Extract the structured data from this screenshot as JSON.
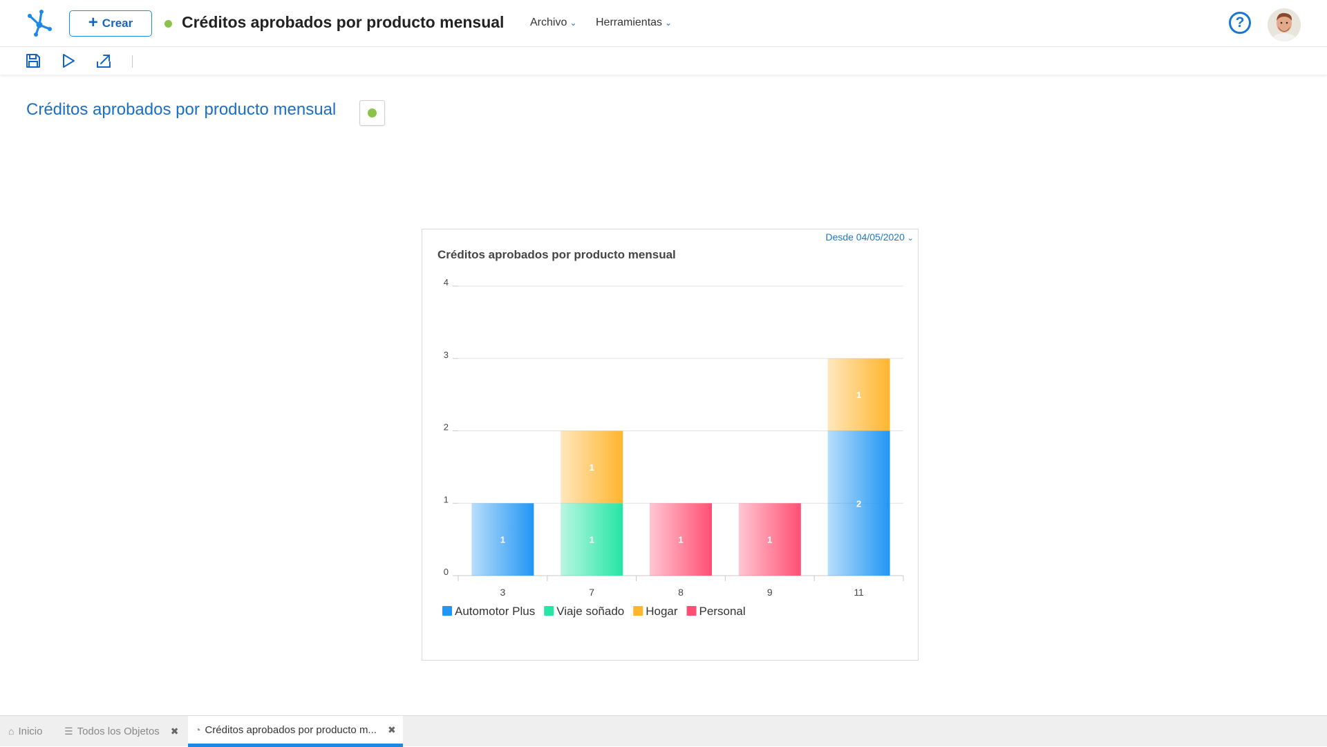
{
  "header": {
    "create_label": "Crear",
    "document_title": "Créditos aprobados por producto mensual",
    "menus": [
      {
        "label": "Archivo"
      },
      {
        "label": "Herramientas"
      }
    ],
    "help_symbol": "?"
  },
  "toolbar": {
    "icons": [
      "save-icon",
      "run-icon",
      "export-icon"
    ]
  },
  "page": {
    "title": "Créditos aprobados por producto mensual"
  },
  "card": {
    "date_filter": "Desde 04/05/2020"
  },
  "colors": {
    "accent": "#1976d2",
    "status_dot": "#8bc34a",
    "automotor_plus": "#2196f3",
    "viaje_sonado": "#26e5a5",
    "hogar": "#ffb52e",
    "personal": "#ff4f73"
  },
  "chart_data": {
    "type": "bar",
    "stacked": true,
    "title": "Créditos aprobados por producto mensual",
    "xlabel": "",
    "ylabel": "",
    "categories": [
      "3",
      "7",
      "8",
      "9",
      "11"
    ],
    "ylim": [
      0,
      4
    ],
    "yticks": [
      0,
      1,
      2,
      3,
      4
    ],
    "grid": true,
    "legend_position": "bottom-left",
    "series": [
      {
        "name": "Automotor Plus",
        "color": "#2196f3",
        "values": [
          1,
          0,
          0,
          0,
          2
        ]
      },
      {
        "name": "Viaje soñado",
        "color": "#26e5a5",
        "values": [
          0,
          1,
          0,
          0,
          0
        ]
      },
      {
        "name": "Hogar",
        "color": "#ffb52e",
        "values": [
          0,
          1,
          0,
          0,
          1
        ]
      },
      {
        "name": "Personal",
        "color": "#ff4f73",
        "values": [
          0,
          0,
          1,
          1,
          0
        ]
      }
    ]
  },
  "tabs": [
    {
      "label": "Inicio",
      "closable": false,
      "active": false
    },
    {
      "label": "Todos los Objetos",
      "closable": true,
      "active": false
    },
    {
      "label": "Créditos aprobados por producto m...",
      "closable": true,
      "active": true
    }
  ]
}
